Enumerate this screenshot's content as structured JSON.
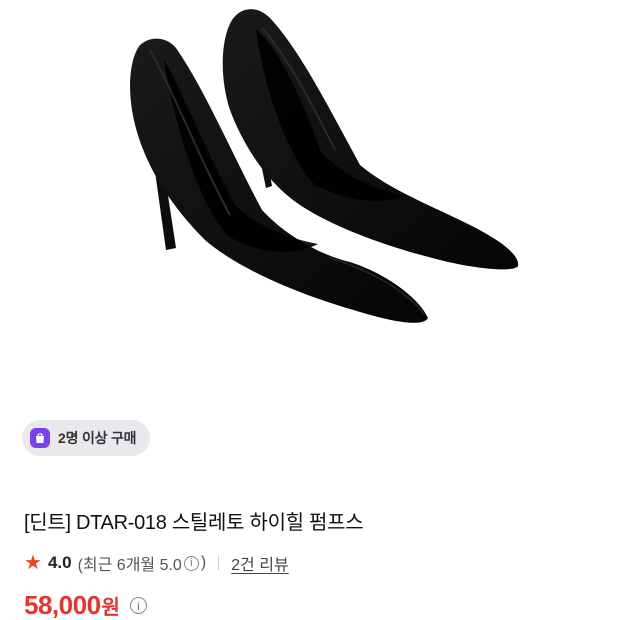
{
  "product": {
    "image_alt": "black pointed stiletto high heel pumps",
    "badge": {
      "icon": "shopping-bag-icon",
      "text": "2명 이상 구매"
    },
    "title": "[딘트] DTAR-018 스틸레토 하이힐 펌프스",
    "rating": {
      "star_icon": "star-icon",
      "score": "4.0",
      "recent_prefix": "(최근 6개월 5.0",
      "recent_suffix": ")",
      "review_count": "2건 리뷰"
    },
    "price": {
      "amount": "58,000",
      "unit": "원"
    }
  },
  "colors": {
    "accent_red": "#e8322f",
    "star": "#f0461e",
    "badge_bg": "#e9e9ed",
    "badge_icon": "#7b3ff2"
  }
}
